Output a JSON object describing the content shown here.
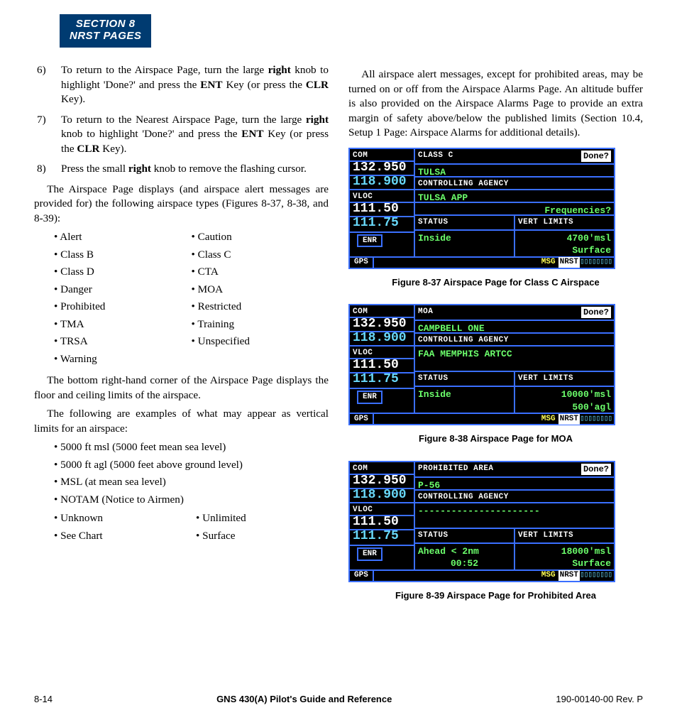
{
  "header": {
    "line1": "SECTION 8",
    "line2": "NRST PAGES"
  },
  "steps": {
    "s6": {
      "num": "6)",
      "pre": "To return to the Airspace Page, turn the large ",
      "b1": "right",
      "mid1": " knob to highlight 'Done?' and press the ",
      "b2": "ENT",
      "mid2": " Key (or press the ",
      "b3": "CLR",
      "post": " Key)."
    },
    "s7": {
      "num": "7)",
      "pre": "To return to the Nearest Airspace Page, turn the large ",
      "b1": "right",
      "mid1": " knob to highlight 'Done?' and press the ",
      "b2": "ENT",
      "mid2": " Key (or press the ",
      "b3": "CLR",
      "post": " Key)."
    },
    "s8": {
      "num": "8)",
      "pre": "Press the small ",
      "b1": "right",
      "post": " knob to remove the flashing cursor."
    }
  },
  "para1": "The Airspace Page displays (and airspace alert messages are provided for) the following airspace types (Figures 8-37, 8-38, and 8-39):",
  "types": {
    "left": [
      "Alert",
      "Class B",
      "Class D",
      "Danger",
      "Prohibited",
      "TMA",
      "TRSA",
      "Warning"
    ],
    "right": [
      "Caution",
      "Class C",
      "CTA",
      "MOA",
      "Restricted",
      "Training",
      "Unspecified"
    ]
  },
  "para2": "The bottom right-hand corner of the Airspace Page displays the floor and ceiling limits of the airspace.",
  "para3": "The following are examples of what may appear as vertical limits for an airspace:",
  "vlimits1": [
    "5000 ft msl (5000 feet mean sea level)",
    "5000 ft agl (5000 feet above ground level)",
    "MSL (at mean sea level)",
    "NOTAM (Notice to Airmen)"
  ],
  "vlimits2": {
    "left": [
      "Unknown",
      "See Chart"
    ],
    "right": [
      "Unlimited",
      "Surface"
    ]
  },
  "rpara": "All airspace alert messages, except for prohibited areas, may be turned on or off from the Airspace Alarms Page. An altitude buffer is also provided on the Airspace Alarms Page to provide an extra margin of safety above/below the published limits (Section 10.4, Setup 1 Page: Airspace Alarms for additional details).",
  "freq": {
    "com_label": "COM",
    "com_active": "132.950",
    "com_standby": "118.900",
    "vloc_label": "VLOC",
    "vloc_active": "111.50",
    "vloc_standby": "111.75",
    "enr": "ENR",
    "gps": "GPS",
    "msg": "MSG",
    "nrst": "NRST",
    "boxes": "▯▯▯▯▯▯▯▯",
    "done": "Done?",
    "ctrl_label": "CONTROLLING AGENCY",
    "status_label": "STATUS",
    "vert_label": "VERT LIMITS",
    "freq_prompt": "Frequencies?"
  },
  "fig37": {
    "type": "CLASS C",
    "name": "TULSA",
    "agency": "TULSA APP",
    "status": "Inside",
    "vtop": "4700'msl",
    "vbot": "Surface",
    "caption": "Figure 8-37  Airspace Page for Class C Airspace"
  },
  "fig38": {
    "type": "MOA",
    "name": "CAMPBELL ONE",
    "agency": "FAA MEMPHIS ARTCC",
    "status": "Inside",
    "vtop": "10000'msl",
    "vbot": "500'agl",
    "caption": "Figure 8-38  Airspace Page for MOA"
  },
  "fig39": {
    "type": "PROHIBITED AREA",
    "name": "P-56",
    "agency": "----------------------",
    "status1": "Ahead < 2nm",
    "status2": "00:52",
    "vtop": "18000'msl",
    "vbot": "Surface",
    "caption": "Figure 8-39  Airspace Page for Prohibited Area"
  },
  "footer": {
    "page": "8-14",
    "title": "GNS 430(A) Pilot's Guide and Reference",
    "rev": "190-00140-00  Rev. P"
  }
}
